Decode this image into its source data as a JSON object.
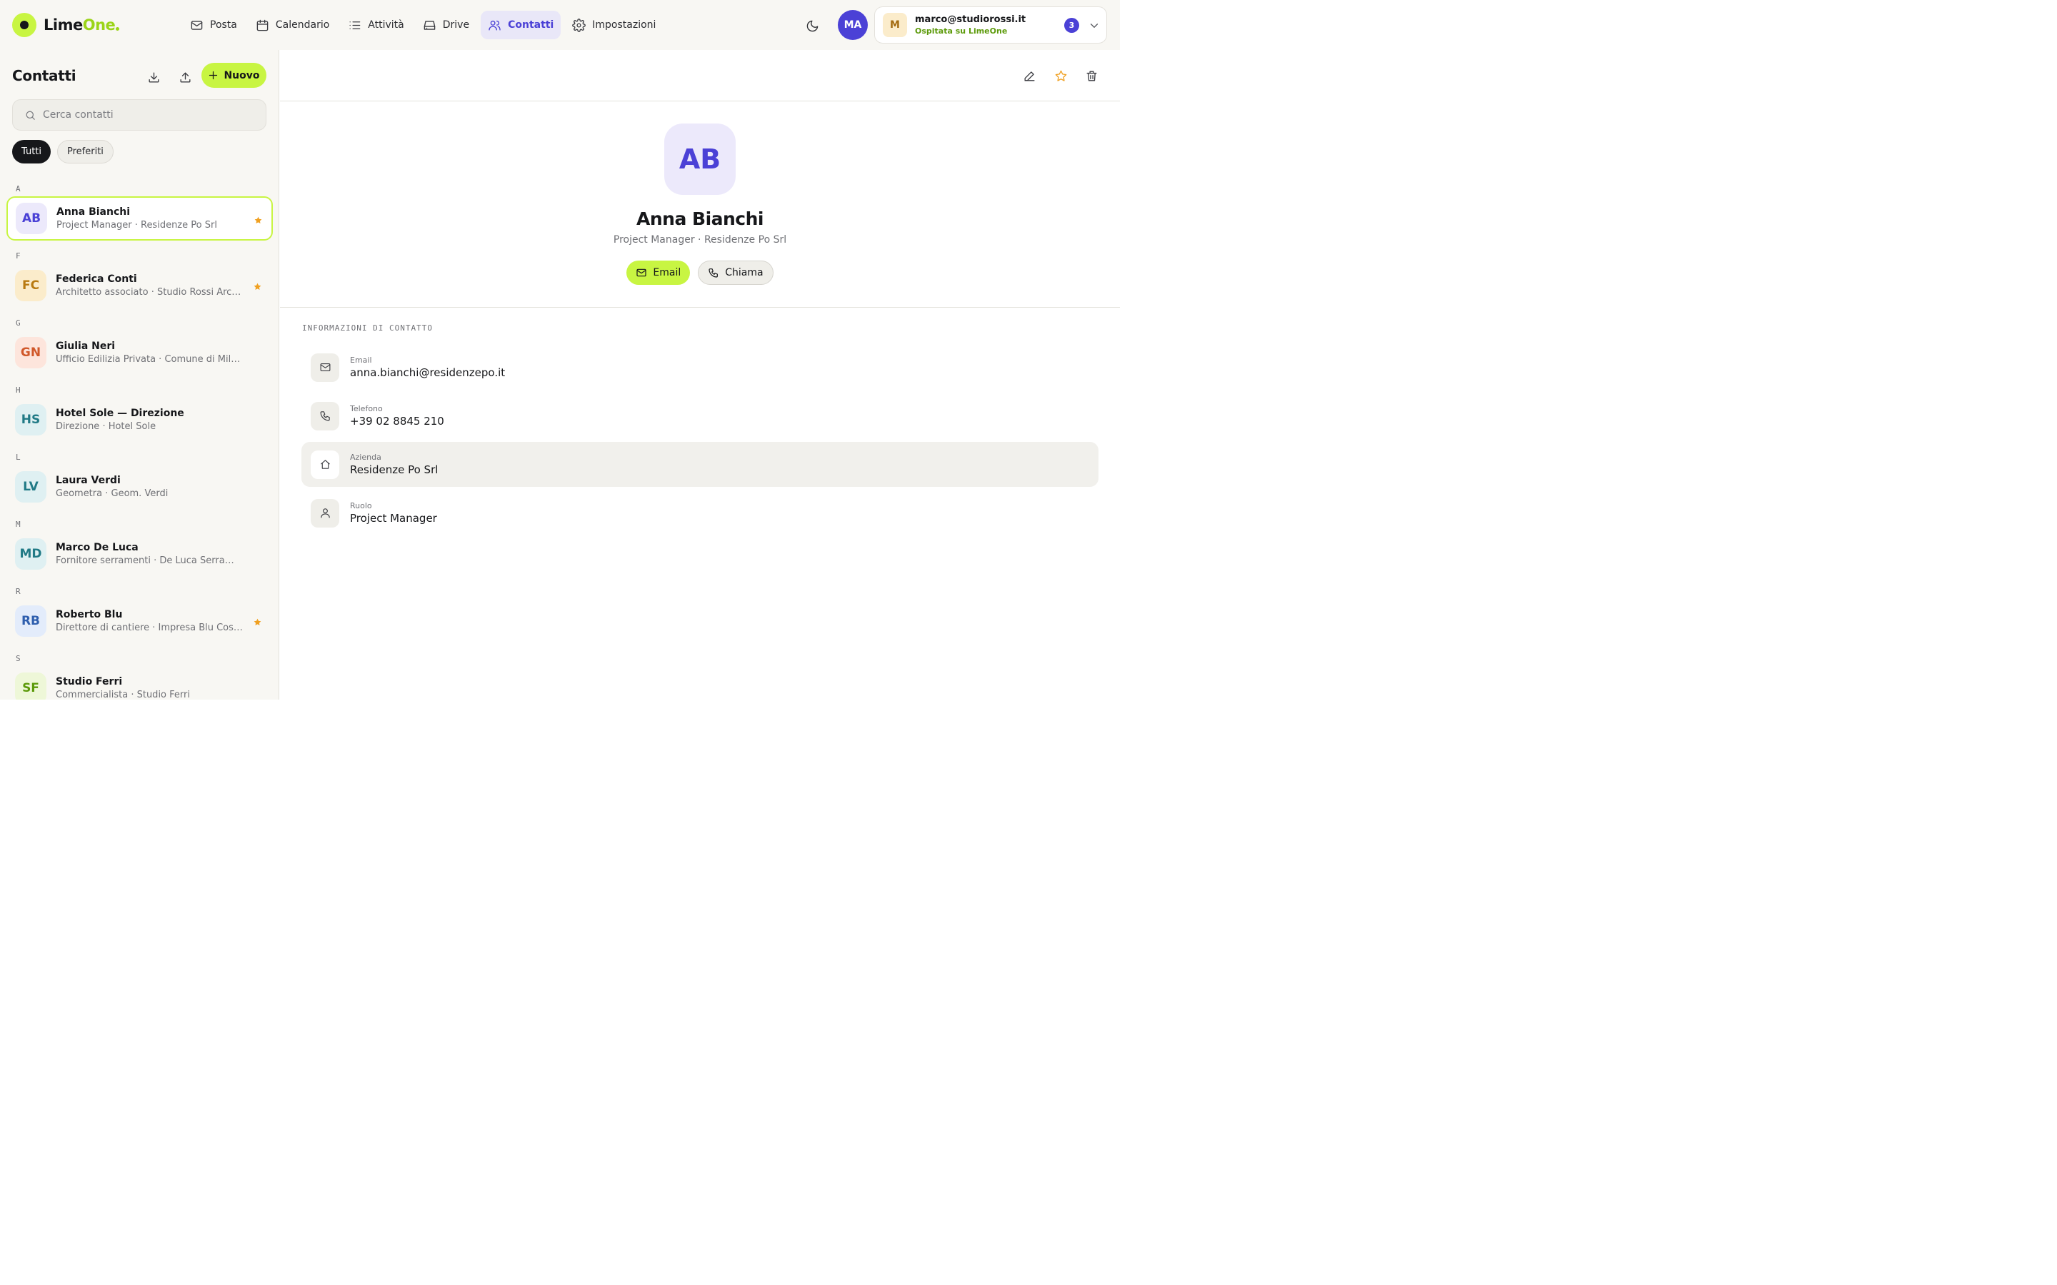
{
  "app": {
    "logo_prefix": "Lime",
    "logo_accent": "One"
  },
  "nav": {
    "items": [
      {
        "label": "Posta",
        "icon": "mail-icon"
      },
      {
        "label": "Calendario",
        "icon": "calendar-icon"
      },
      {
        "label": "Attività",
        "icon": "tasks-icon"
      },
      {
        "label": "Drive",
        "icon": "drive-icon"
      },
      {
        "label": "Contatti",
        "icon": "contacts-icon",
        "active": true
      },
      {
        "label": "Impostazioni",
        "icon": "gear-icon"
      }
    ]
  },
  "user": {
    "initials": "MA",
    "account_initial": "M",
    "email": "marco@studiorossi.it",
    "hosted_label": "Ospitata su LimeOne",
    "badge_count": "3"
  },
  "sidebar": {
    "title": "Contatti",
    "new_label": "Nuovo",
    "search_placeholder": "Cerca contatti",
    "filters": [
      {
        "label": "Tutti",
        "active": true
      },
      {
        "label": "Preferiti",
        "active": false
      }
    ],
    "groups": [
      {
        "letter": "A",
        "contacts": [
          {
            "initials": "AB",
            "name": "Anna Bianchi",
            "subtitle": "Project Manager · Residenze Po Srl",
            "favorite": true,
            "selected": true,
            "bg": "#ece9fb",
            "fg": "#4b41d6"
          }
        ]
      },
      {
        "letter": "F",
        "contacts": [
          {
            "initials": "FC",
            "name": "Federica Conti",
            "subtitle": "Architetto associato · Studio Rossi Architetti",
            "favorite": true,
            "bg": "#fbeccb",
            "fg": "#b87a12"
          }
        ]
      },
      {
        "letter": "G",
        "contacts": [
          {
            "initials": "GN",
            "name": "Giulia Neri",
            "subtitle": "Ufficio Edilizia Privata · Comune di Milano",
            "favorite": false,
            "bg": "#fde5dc",
            "fg": "#d0582a"
          }
        ]
      },
      {
        "letter": "H",
        "contacts": [
          {
            "initials": "HS",
            "name": "Hotel Sole — Direzione",
            "subtitle": "Direzione · Hotel Sole",
            "favorite": false,
            "bg": "#dff0f2",
            "fg": "#217a86"
          }
        ]
      },
      {
        "letter": "L",
        "contacts": [
          {
            "initials": "LV",
            "name": "Laura Verdi",
            "subtitle": "Geometra · Geom. Verdi",
            "favorite": false,
            "bg": "#dff0f2",
            "fg": "#217a86"
          }
        ]
      },
      {
        "letter": "M",
        "contacts": [
          {
            "initials": "MD",
            "name": "Marco De Luca",
            "subtitle": "Fornitore serramenti · De Luca Serramenti",
            "favorite": false,
            "bg": "#dff0f2",
            "fg": "#217a86"
          }
        ]
      },
      {
        "letter": "R",
        "contacts": [
          {
            "initials": "RB",
            "name": "Roberto Blu",
            "subtitle": "Direttore di cantiere · Impresa Blu Costruzioni",
            "favorite": true,
            "bg": "#e3ecfb",
            "fg": "#2f5fae"
          }
        ]
      },
      {
        "letter": "S",
        "contacts": [
          {
            "initials": "SF",
            "name": "Studio Ferri",
            "subtitle": "Commercialista · Studio Ferri",
            "favorite": false,
            "bg": "#eef7d8",
            "fg": "#5c9a0a"
          }
        ]
      }
    ]
  },
  "detail": {
    "initials": "AB",
    "name": "Anna Bianchi",
    "subtitle": "Project Manager · Residenze Po Srl",
    "email_button": "Email",
    "call_button": "Chiama",
    "section_title": "INFORMAZIONI DI CONTATTO",
    "fields": [
      {
        "icon": "mail-icon",
        "label": "Email",
        "value": "anna.bianchi@residenzepo.it"
      },
      {
        "icon": "phone-icon",
        "label": "Telefono",
        "value": "+39 02 8845 210"
      },
      {
        "icon": "home-icon",
        "label": "Azienda",
        "value": "Residenze Po Srl"
      },
      {
        "icon": "user-icon",
        "label": "Ruolo",
        "value": "Project Manager"
      }
    ]
  },
  "colors": {
    "accent_lime": "#c8f542",
    "accent_indigo": "#4b41d6",
    "favorite_star": "#f0a020"
  }
}
